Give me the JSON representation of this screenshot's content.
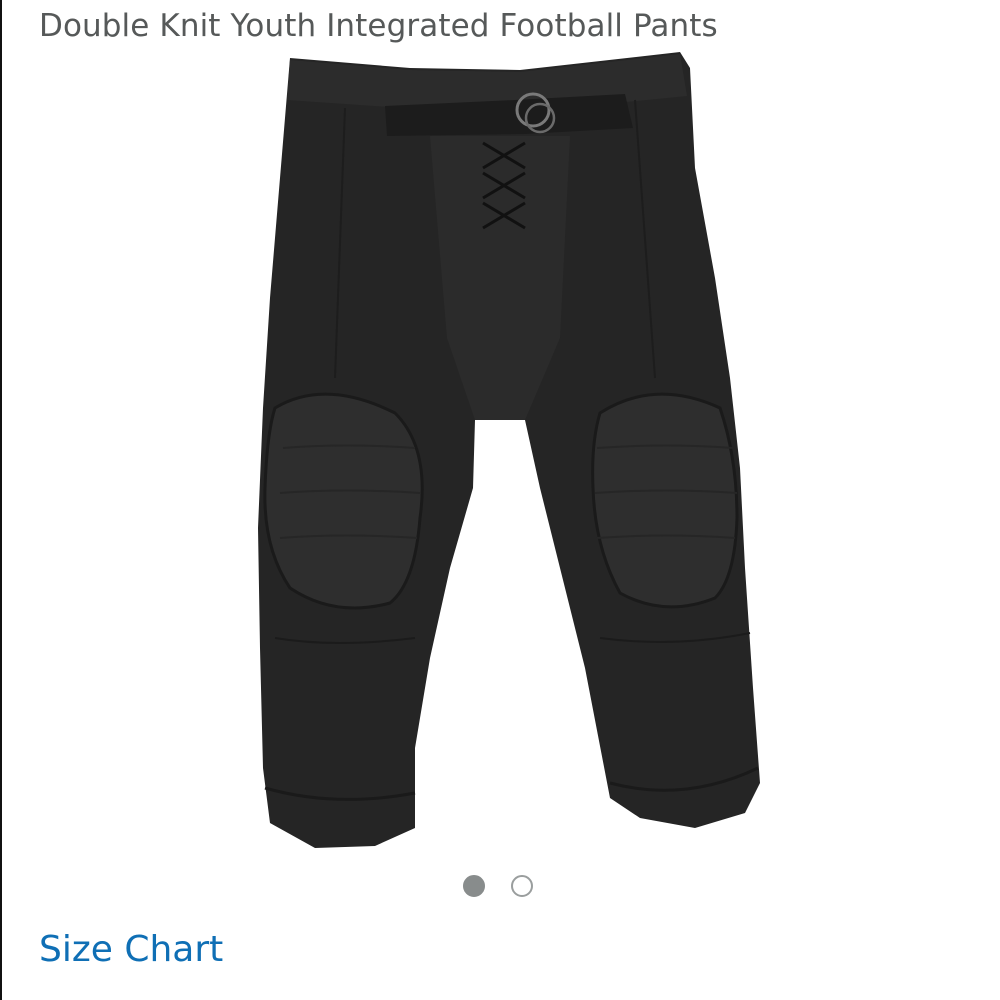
{
  "product": {
    "title": "Double Knit Youth Integrated Football Pants",
    "image_icon": "football-pants-image"
  },
  "carousel": {
    "total": 2,
    "active_index": 1
  },
  "links": {
    "size_chart": "Size Chart"
  },
  "colors": {
    "title_text": "#565959",
    "link": "#0f6fb5",
    "dot_active": "#888c8c",
    "garment": "#252525"
  }
}
